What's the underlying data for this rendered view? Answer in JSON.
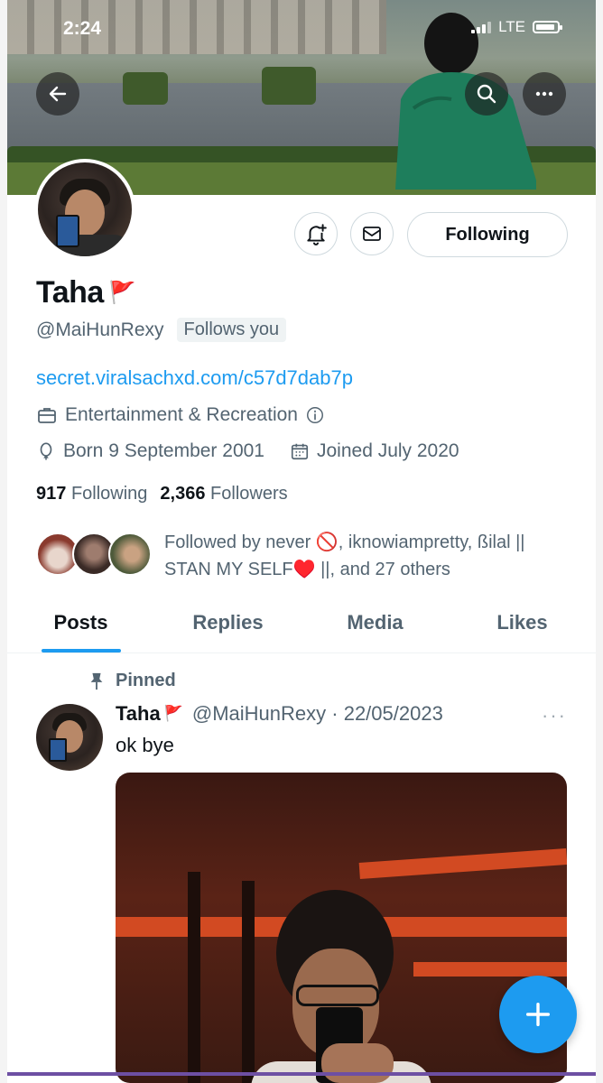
{
  "status_bar": {
    "time": "2:24",
    "network": "LTE"
  },
  "header": {
    "back_icon": "arrow-left-icon",
    "search_icon": "search-icon",
    "more_icon": "more-horizontal-icon"
  },
  "profile": {
    "name": "Taha",
    "name_emoji": "🚩",
    "handle": "@MaiHunRexy",
    "follows_you_label": "Follows you",
    "website": "secret.viralsachxd.com/c57d7dab7p",
    "category": "Entertainment & Recreation",
    "born": "Born 9 September 2001",
    "joined": "Joined July 2020",
    "following_count": "917",
    "following_label": "Following",
    "followers_count": "2,366",
    "followers_label": "Followers",
    "followed_by": "Followed by never 🚫, iknowiampretty, ßilal || STAN MY SELF♥️ ||, and 27 others"
  },
  "actions": {
    "notify_icon": "bell-plus-icon",
    "message_icon": "mail-icon",
    "following_button": "Following"
  },
  "tabs": [
    {
      "label": "Posts",
      "active": true
    },
    {
      "label": "Replies",
      "active": false
    },
    {
      "label": "Media",
      "active": false
    },
    {
      "label": "Likes",
      "active": false
    }
  ],
  "pinned_post": {
    "pinned_label": "Pinned",
    "author_name": "Taha",
    "author_emoji": "🚩",
    "author_handle_date": "@MaiHunRexy · 22/05/2023",
    "more": "···",
    "text": "ok bye"
  },
  "fab": {
    "icon": "plus-icon"
  },
  "colors": {
    "accent": "#1d9bf0",
    "secondary_text": "#536471",
    "primary_text": "#0f1419"
  }
}
